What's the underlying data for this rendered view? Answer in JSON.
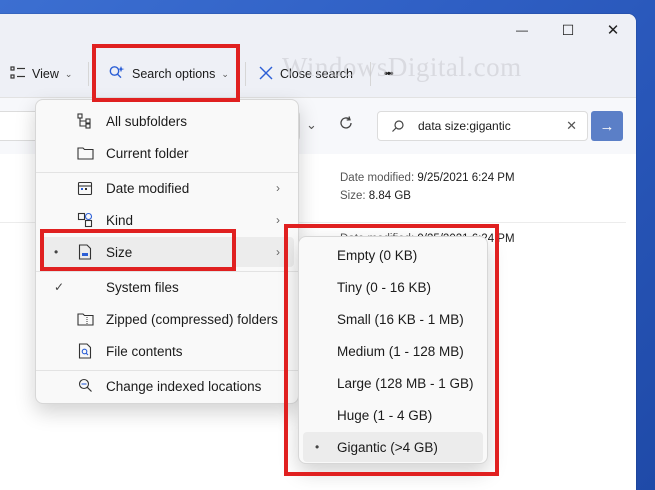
{
  "window": {
    "minimize": "—",
    "maximize": "☐",
    "close": "✕"
  },
  "toolbar": {
    "view_label": "View",
    "search_options_label": "Search options",
    "close_search_label": "Close search",
    "more_label": "•••"
  },
  "watermark": "WindowsDigital.com",
  "search": {
    "value": "data size:gigantic"
  },
  "files": [
    {
      "date_label": "Date modified:",
      "date": "9/25/2021 6:24 PM",
      "size_label": "Size:",
      "size": "8.84 GB"
    },
    {
      "date_label": "Date modified:",
      "date": "9/25/2021 6:24 PM"
    }
  ],
  "menu": {
    "items": [
      {
        "label": "All subfolders",
        "icon": "subfolders-icon"
      },
      {
        "label": "Current folder",
        "icon": "folder-icon"
      },
      {
        "label": "Date modified",
        "icon": "calendar-icon"
      },
      {
        "label": "Kind",
        "icon": "kind-icon"
      },
      {
        "label": "Size",
        "icon": "size-icon",
        "selected": true
      },
      {
        "label": "System files",
        "icon": "system-files-icon",
        "checked": true
      },
      {
        "label": "Zipped (compressed) folders",
        "icon": "zip-folder-icon"
      },
      {
        "label": "File contents",
        "icon": "file-search-icon"
      },
      {
        "label": "Change indexed locations",
        "icon": "indexed-locations-icon"
      }
    ]
  },
  "size_menu": {
    "items": [
      {
        "label": "Empty (0 KB)"
      },
      {
        "label": "Tiny (0 - 16 KB)"
      },
      {
        "label": "Small (16 KB - 1 MB)"
      },
      {
        "label": "Medium (1 - 128 MB)"
      },
      {
        "label": "Large (128 MB - 1 GB)"
      },
      {
        "label": "Huge (1 - 4 GB)"
      },
      {
        "label": "Gigantic (>4 GB)",
        "selected": true
      }
    ]
  },
  "colors": {
    "highlight_box": "#e02020",
    "accent": "#5b7fc7"
  }
}
